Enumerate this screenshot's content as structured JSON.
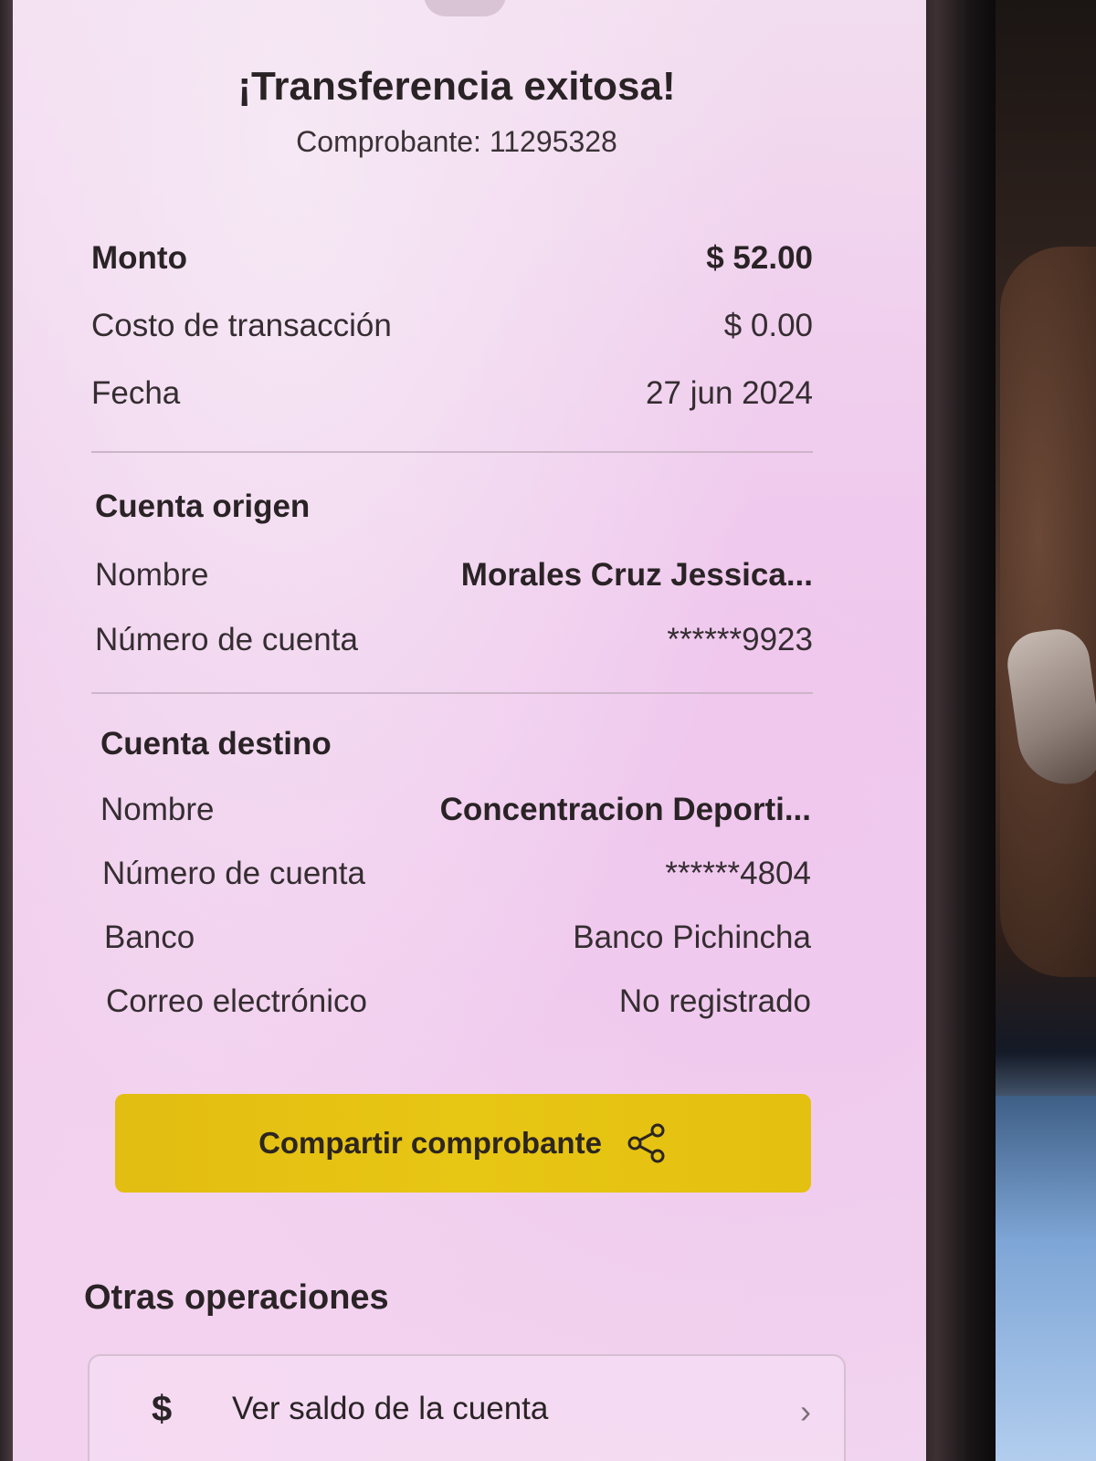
{
  "header": {
    "title": "¡Transferencia exitosa!",
    "receipt": "Comprobante: 11295328"
  },
  "summary": {
    "amount_label": "Monto",
    "amount_value": "$ 52.00",
    "fee_label": "Costo de transacción",
    "fee_value": "$ 0.00",
    "date_label": "Fecha",
    "date_value": "27 jun 2024"
  },
  "origin": {
    "title": "Cuenta origen",
    "name_label": "Nombre",
    "name_value": "Morales  Cruz Jessica...",
    "account_label": "Número de cuenta",
    "account_value": "******9923"
  },
  "destination": {
    "title": "Cuenta destino",
    "name_label": "Nombre",
    "name_value": "Concentracion Deporti...",
    "account_label": "Número de cuenta",
    "account_value": "******4804",
    "bank_label": "Banco",
    "bank_value": "Banco Pichincha",
    "email_label": "Correo electrónico",
    "email_value": "No registrado"
  },
  "actions": {
    "share_label": "Compartir comprobante",
    "share_icon": "share-icon"
  },
  "other_operations": {
    "title": "Otras operaciones",
    "items": [
      {
        "icon": "dollar-icon",
        "icon_glyph": "$",
        "label": "Ver saldo de la cuenta",
        "chevron": "chevron-right-icon"
      }
    ]
  },
  "colors": {
    "screen_tint": "#eec9ec",
    "accent_button": "#e6c212",
    "text_primary": "#2a2326"
  }
}
